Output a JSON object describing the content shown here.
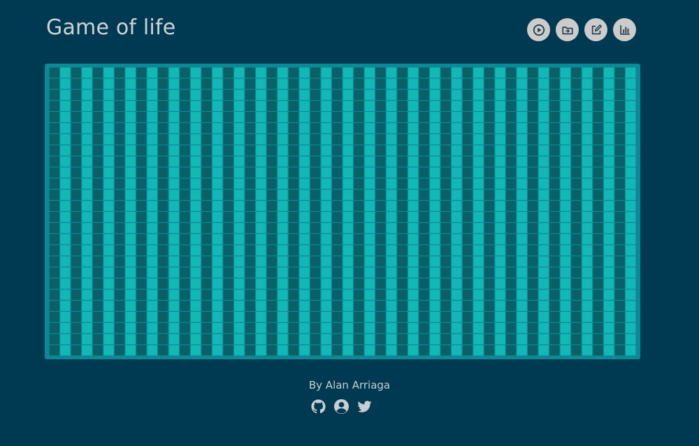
{
  "header": {
    "title": "Game of life"
  },
  "toolbar": {
    "buttons": [
      {
        "icon": "play-icon"
      },
      {
        "icon": "folder-icon"
      },
      {
        "icon": "edit-icon"
      },
      {
        "icon": "chart-icon"
      }
    ]
  },
  "board": {
    "columns": 54,
    "rows": 26,
    "live_columns": [
      1,
      3,
      5,
      7,
      9,
      11,
      13,
      15,
      17,
      19,
      21,
      23,
      25,
      27,
      29,
      31,
      33,
      35,
      37,
      39,
      41,
      43,
      45,
      47,
      49,
      51,
      53
    ],
    "colors": {
      "board_bg": "#0b8a95",
      "dead_cell": "#0b5f66",
      "live_cell": "#11b8b6"
    }
  },
  "footer": {
    "credit": "By Alan Arriaga",
    "links": [
      {
        "icon": "github-icon"
      },
      {
        "icon": "user-circle-icon"
      },
      {
        "icon": "twitter-icon"
      }
    ]
  },
  "colors": {
    "page_bg": "#003a52",
    "text": "#cfd3d6",
    "button_bg": "#cccccc",
    "icon": "#1f3b4a"
  }
}
